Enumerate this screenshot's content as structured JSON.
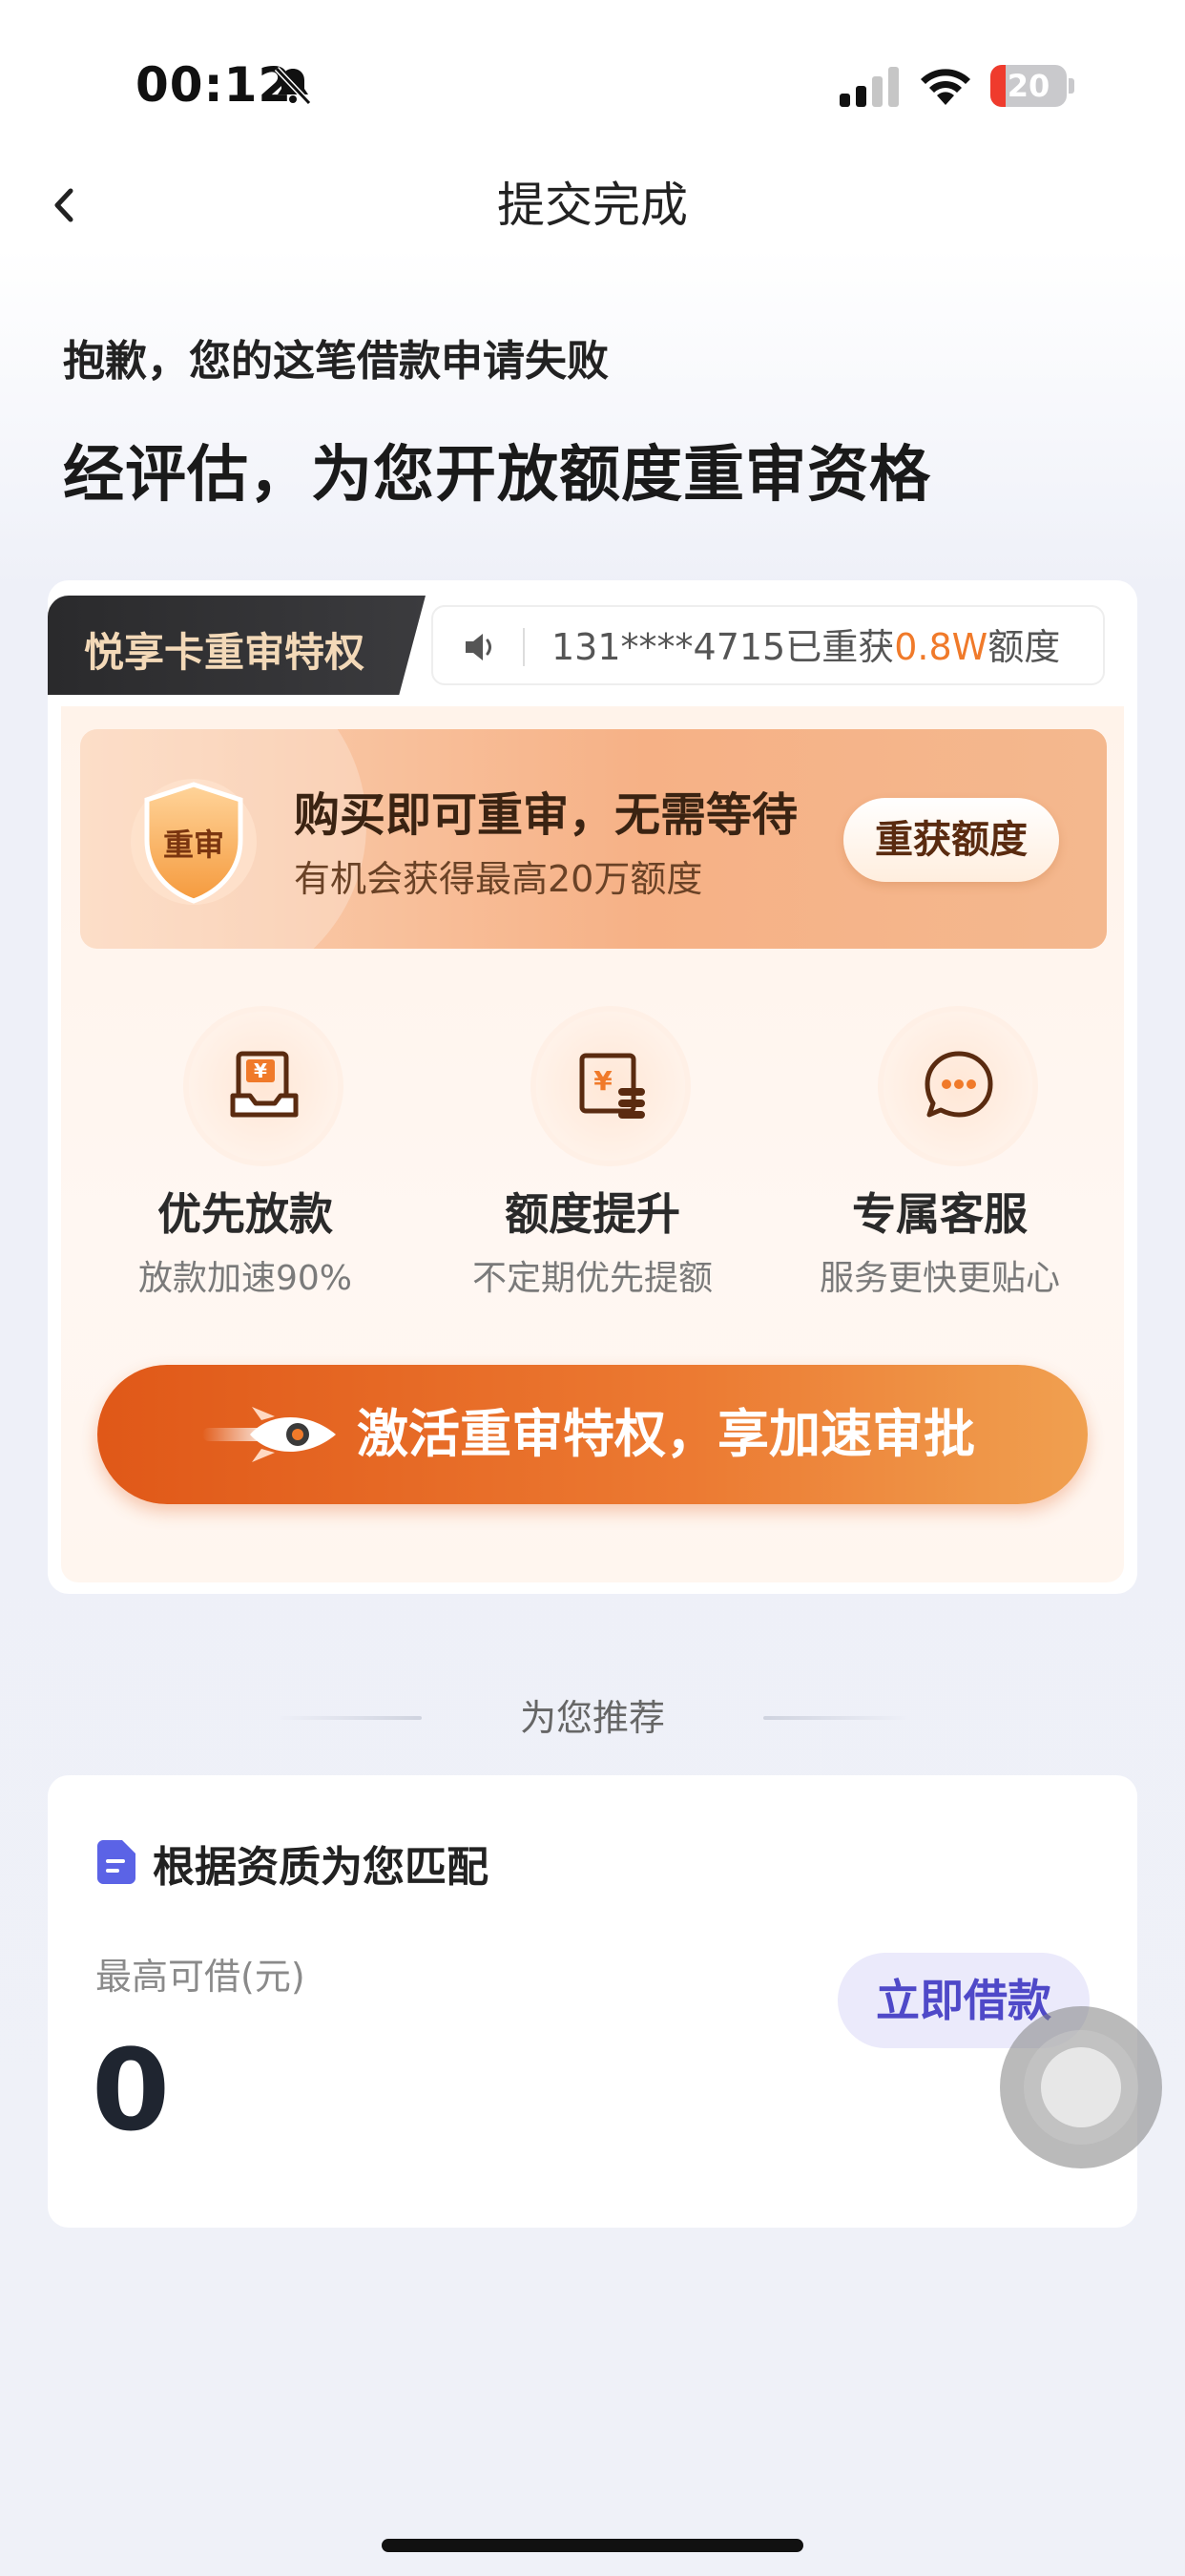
{
  "status_bar": {
    "time": "00:12",
    "battery": "20",
    "battery_fraction": 0.2
  },
  "nav": {
    "title": "提交完成",
    "back_icon": "chevron-left-icon"
  },
  "result": {
    "sorry_text": "抱歉，您的这笔借款申请失败",
    "headline": "经评估，为您开放额度重审资格"
  },
  "privilege_card": {
    "tab_label": "悦享卡重审特权",
    "ticker": {
      "prefix": "131****4715已重获",
      "amount": "0.8W",
      "suffix": "额度"
    },
    "banner": {
      "badge": "重审",
      "title": "购买即可重审，无需等待",
      "subtitle": "有机会获得最高20万额度",
      "button": "重获额度"
    },
    "features": [
      {
        "title": "优先放款",
        "subtitle": "放款加速90%",
        "icon": "yuan-document-icon"
      },
      {
        "title": "额度提升",
        "subtitle": "不定期优先提额",
        "icon": "yuan-coins-icon"
      },
      {
        "title": "专属客服",
        "subtitle": "服务更快更贴心",
        "icon": "chat-bubble-icon"
      }
    ],
    "cta": "激活重审特权，享加速审批"
  },
  "recommend": {
    "section_title": "为您推荐",
    "card_title": "根据资质为您匹配",
    "max_label": "最高可借(元)",
    "max_value": "0",
    "button": "立即借款"
  },
  "colors": {
    "accent_orange": "#f07a2a",
    "cta_start": "#e05818",
    "cta_end": "#f0a050",
    "borrow_text": "#4f49c8",
    "borrow_bg": "#ebeafb"
  }
}
